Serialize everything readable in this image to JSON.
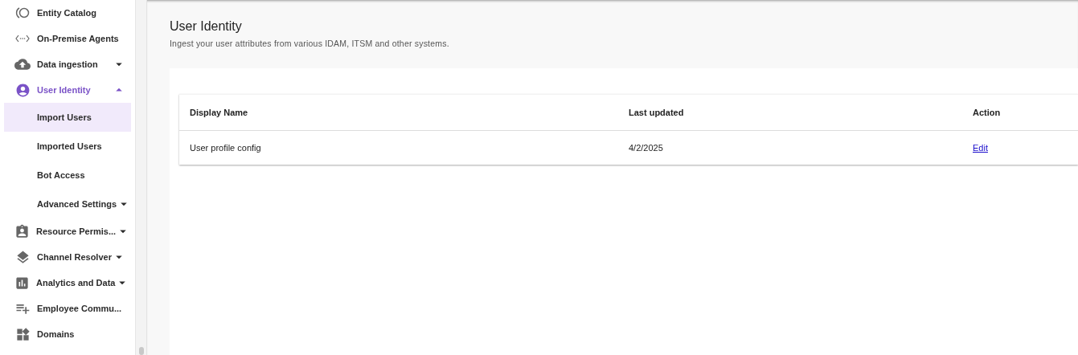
{
  "sidebar": {
    "items": [
      {
        "label": "Entity Catalog",
        "selected": false
      },
      {
        "label": "On-Premise Agents",
        "selected": false
      },
      {
        "label": "Data ingestion",
        "selected": false,
        "expanded": false
      },
      {
        "label": "User Identity",
        "selected": true,
        "expanded": true,
        "children": [
          {
            "label": "Import Users",
            "selected": true
          },
          {
            "label": "Imported Users",
            "selected": false
          },
          {
            "label": "Bot Access",
            "selected": false
          },
          {
            "label": "Advanced Settings",
            "selected": false,
            "expanded": false
          }
        ]
      },
      {
        "label": "Resource Permis...",
        "selected": false,
        "expanded": false
      },
      {
        "label": "Channel Resolver",
        "selected": false,
        "expanded": false
      },
      {
        "label": "Analytics and Data",
        "selected": false,
        "expanded": false
      },
      {
        "label": "Employee Commu...",
        "selected": false
      },
      {
        "label": "Domains",
        "selected": false
      }
    ]
  },
  "page": {
    "title": "User Identity",
    "subtitle": "Ingest your user attributes from various IDAM, ITSM and other systems."
  },
  "table": {
    "columns": [
      "Display Name",
      "Last updated",
      "Action"
    ],
    "rows": [
      {
        "display_name": "User profile config",
        "last_updated": "4/2/2025",
        "action": "Edit"
      }
    ]
  }
}
